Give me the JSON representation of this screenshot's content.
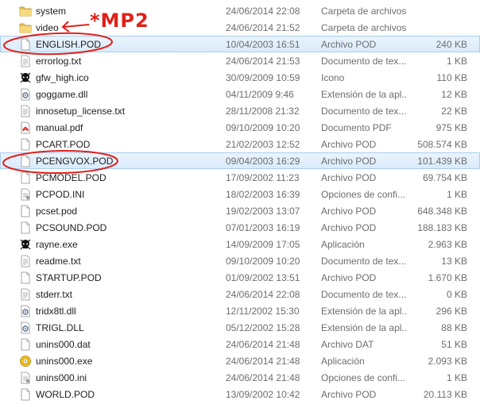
{
  "files": [
    {
      "name": "system",
      "date": "24/06/2014 22:08",
      "type": "Carpeta de archivos",
      "size": "",
      "icon": "folder-icon"
    },
    {
      "name": "video",
      "date": "24/06/2014 21:52",
      "type": "Carpeta de archivos",
      "size": "",
      "icon": "folder-icon"
    },
    {
      "name": "ENGLISH.POD",
      "date": "10/04/2003 16:51",
      "type": "Archivo POD",
      "size": "240 KB",
      "icon": "file-icon",
      "selected": true
    },
    {
      "name": "errorlog.txt",
      "date": "24/06/2014 21:53",
      "type": "Documento de tex...",
      "size": "1 KB",
      "icon": "text-file-icon"
    },
    {
      "name": "gfw_high.ico",
      "date": "30/09/2009 10:59",
      "type": "Icono",
      "size": "110 KB",
      "icon": "skull-icon"
    },
    {
      "name": "goggame.dll",
      "date": "04/11/2009 9:46",
      "type": "Extensión de la apl...",
      "size": "12 KB",
      "icon": "dll-file-icon"
    },
    {
      "name": "innosetup_license.txt",
      "date": "28/11/2008 21:32",
      "type": "Documento de tex...",
      "size": "22 KB",
      "icon": "text-file-icon"
    },
    {
      "name": "manual.pdf",
      "date": "09/10/2009 10:20",
      "type": "Documento PDF",
      "size": "975 KB",
      "icon": "pdf-file-icon"
    },
    {
      "name": "PCART.POD",
      "date": "21/02/2003 12:52",
      "type": "Archivo POD",
      "size": "508.574 KB",
      "icon": "file-icon"
    },
    {
      "name": "PCENGVOX.POD",
      "date": "09/04/2003 16:29",
      "type": "Archivo POD",
      "size": "101.439 KB",
      "icon": "file-icon",
      "selected": true
    },
    {
      "name": "PCMODEL.POD",
      "date": "17/09/2002 11:23",
      "type": "Archivo POD",
      "size": "69.754 KB",
      "icon": "file-icon"
    },
    {
      "name": "PCPOD.INI",
      "date": "18/02/2003 16:39",
      "type": "Opciones de confi...",
      "size": "1 KB",
      "icon": "ini-file-icon"
    },
    {
      "name": "pcset.pod",
      "date": "19/02/2003 13:07",
      "type": "Archivo POD",
      "size": "648.348 KB",
      "icon": "file-icon"
    },
    {
      "name": "PCSOUND.POD",
      "date": "07/01/2003 16:19",
      "type": "Archivo POD",
      "size": "188.183 KB",
      "icon": "file-icon"
    },
    {
      "name": "rayne.exe",
      "date": "14/09/2009 17:05",
      "type": "Aplicación",
      "size": "2.963 KB",
      "icon": "skull-icon"
    },
    {
      "name": "readme.txt",
      "date": "09/10/2009 10:20",
      "type": "Documento de tex...",
      "size": "13 KB",
      "icon": "text-file-icon"
    },
    {
      "name": "STARTUP.POD",
      "date": "01/09/2002 13:51",
      "type": "Archivo POD",
      "size": "1.670 KB",
      "icon": "file-icon"
    },
    {
      "name": "stderr.txt",
      "date": "24/06/2014 22:08",
      "type": "Documento de tex...",
      "size": "0 KB",
      "icon": "text-file-icon"
    },
    {
      "name": "tridx8tl.dll",
      "date": "12/11/2002 15:30",
      "type": "Extensión de la apl...",
      "size": "296 KB",
      "icon": "dll-file-icon"
    },
    {
      "name": "TRIGL.DLL",
      "date": "05/12/2002 15:28",
      "type": "Extensión de la apl...",
      "size": "88 KB",
      "icon": "dll-file-icon"
    },
    {
      "name": "unins000.dat",
      "date": "24/06/2014 21:48",
      "type": "Archivo DAT",
      "size": "51 KB",
      "icon": "file-icon"
    },
    {
      "name": "unins000.exe",
      "date": "24/06/2014 21:48",
      "type": "Aplicación",
      "size": "2.093 KB",
      "icon": "installer-icon"
    },
    {
      "name": "unins000.ini",
      "date": "24/06/2014 21:48",
      "type": "Opciones de confi...",
      "size": "1 KB",
      "icon": "ini-file-icon"
    },
    {
      "name": "WORLD.POD",
      "date": "13/09/2002 10:42",
      "type": "Archivo POD",
      "size": "20.113 KB",
      "icon": "file-icon"
    }
  ],
  "annotation": {
    "text": "*MP2",
    "color": "#e0201b"
  }
}
